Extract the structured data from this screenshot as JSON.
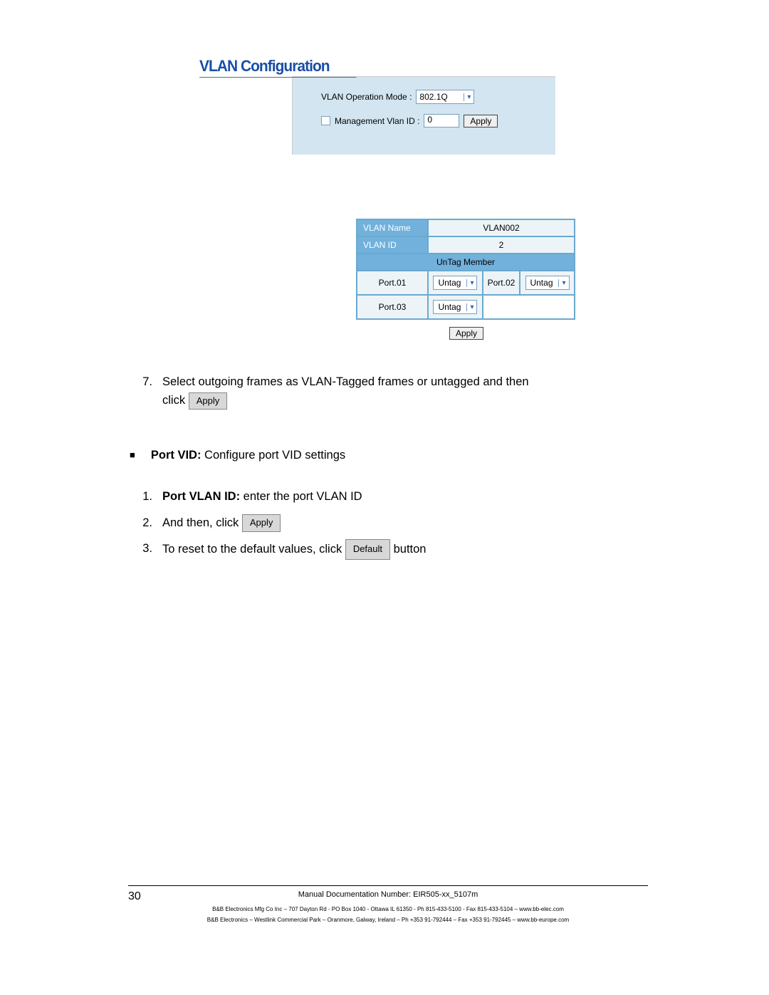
{
  "screenshot": {
    "heading": "VLAN Configuration",
    "operation_mode_label": "VLAN Operation Mode :",
    "operation_mode_value": "802.1Q",
    "mgmt_vlan_label": "Management Vlan ID :",
    "mgmt_vlan_value": "0",
    "apply_label": "Apply",
    "table": {
      "vlan_name_label": "VLAN Name",
      "vlan_name_value": "VLAN002",
      "vlan_id_label": "VLAN ID",
      "vlan_id_value": "2",
      "section_label": "UnTag Member",
      "port1_label": "Port.01",
      "port2_label": "Port.02",
      "port3_label": "Port.03",
      "untag_value": "Untag"
    }
  },
  "instructions": {
    "step7_num": "7.",
    "step7_text_a": "Select outgoing frames as VLAN-Tagged frames or untagged and then",
    "step7_text_b": "click",
    "apply_btn": "Apply",
    "bullet_label_bold": "Port VID:",
    "bullet_label_rest": " Configure port VID settings",
    "s1_num": "1.",
    "s1_bold": "Port VLAN ID:",
    "s1_rest": " enter the port VLAN ID",
    "s2_num": "2.",
    "s2_text": "And then, click ",
    "s3_num": "3.",
    "s3_text_a": "To reset to the default values, click ",
    "default_btn": "Default",
    "s3_text_b": " button"
  },
  "footer": {
    "page_number": "30",
    "doc_line": "Manual Documentation Number: EIR505-xx_5107m",
    "tiny1": "B&B Electronics Mfg Co Inc – 707 Dayton Rd - PO Box 1040 - Ottawa IL 61350 - Ph 815-433-5100 - Fax 815-433-5104 – www.bb-elec.com",
    "tiny2": "B&B Electronics – Westlink Commercial Park – Oranmore, Galway, Ireland – Ph +353 91-792444 – Fax +353 91-792445 – www.bb-europe.com"
  }
}
